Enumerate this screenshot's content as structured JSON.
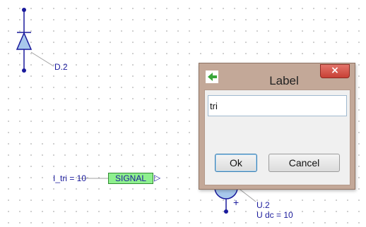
{
  "schematic": {
    "diode_label": "D.2",
    "source_label": "U.2",
    "source_value": "U dc = 10",
    "source_polarity": "+",
    "signal_expression": "I_tri = 10",
    "signal_tag": "SIGNAL",
    "signal_arrow": "▷"
  },
  "dialog": {
    "title": "Label",
    "close_symbol": "×",
    "input_value": "tri",
    "ok_label": "Ok",
    "cancel_label": "Cancel"
  },
  "colors": {
    "wire": "#1a1a9c",
    "signal_fill": "#8ef08e",
    "close_red": "#c74035",
    "dialog_frame": "#c3a898"
  },
  "icons": {
    "app": "green-arrow-icon"
  }
}
